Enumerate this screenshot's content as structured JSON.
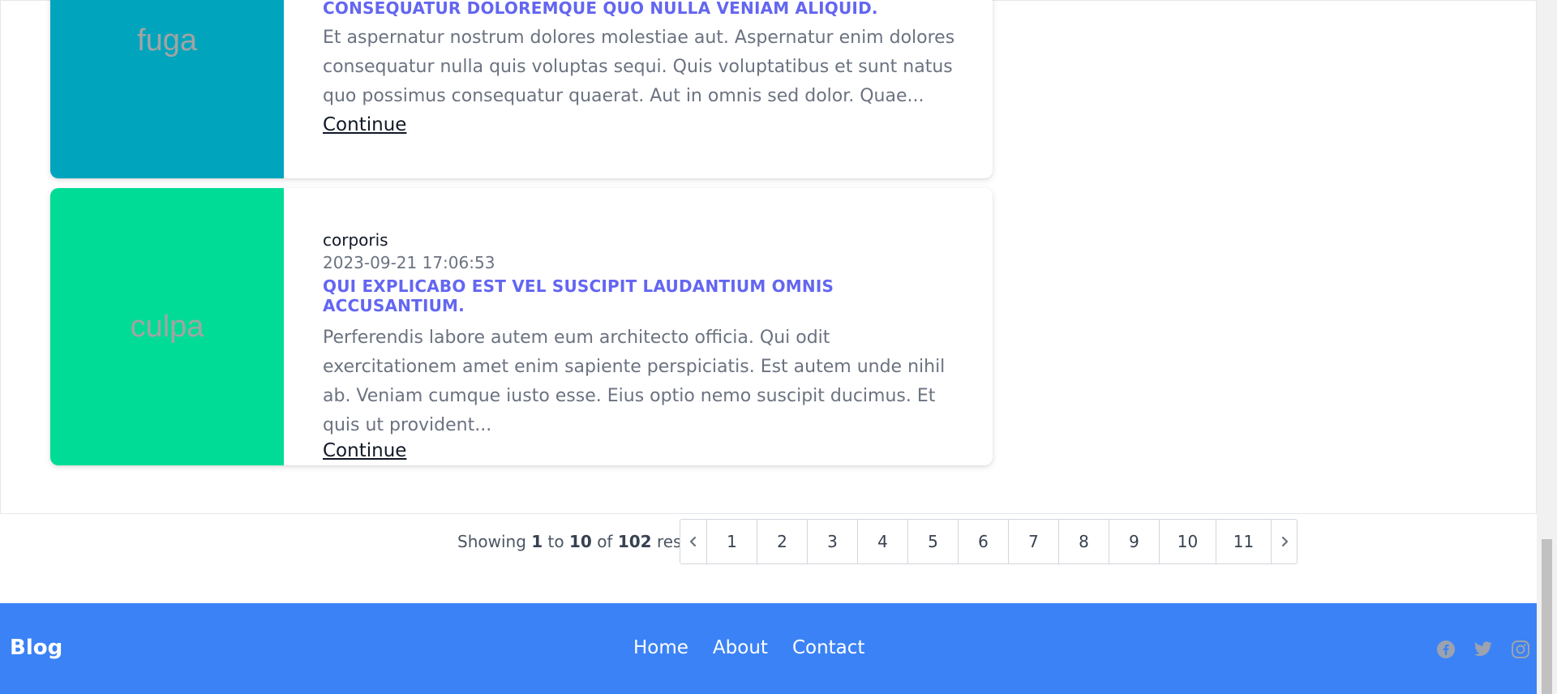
{
  "posts": [
    {
      "image_text": "fuga",
      "image_color": "#00a5bd",
      "title": "Consequatur doloremque quo nulla veniam aliquid.",
      "excerpt": "Et aspernatur nostrum dolores molestiae aut. Aspernatur enim dolores consequatur nulla quis voluptas sequi. Quis voluptatibus et sunt natus quo possimus consequatur quaerat. Aut in omnis sed dolor. Quae...",
      "continue_label": "Continue"
    },
    {
      "image_text": "culpa",
      "image_color": "#00dc95",
      "category": "corporis",
      "date": "2023-09-21 17:06:53",
      "title": "Qui explicabo est vel suscipit laudantium omnis accusantium.",
      "excerpt": "Perferendis labore autem eum architecto officia. Qui odit exercitationem amet enim sapiente perspiciatis. Est autem unde nihil ab. Veniam cumque iusto esse. Eius optio nemo suscipit ducimus. Et quis ut provident...",
      "continue_label": "Continue"
    }
  ],
  "pagination": {
    "showing_prefix": "Showing",
    "from": "1",
    "to_word": "to",
    "to": "10",
    "of_word": "of",
    "total": "102",
    "results_word": "results",
    "prev_icon": "chevron-left-icon",
    "next_icon": "chevron-right-icon",
    "pages": [
      "1",
      "2",
      "3",
      "4",
      "5",
      "6",
      "7",
      "8",
      "9",
      "10",
      "11"
    ]
  },
  "footer": {
    "brand": "Blog",
    "nav": [
      "Home",
      "About",
      "Contact"
    ],
    "social_icons": [
      "facebook-icon",
      "twitter-icon",
      "instagram-icon"
    ],
    "background": "#3b82f6"
  },
  "colors": {
    "accent_title": "#6366f1",
    "social_icon": "#9ca3af"
  }
}
